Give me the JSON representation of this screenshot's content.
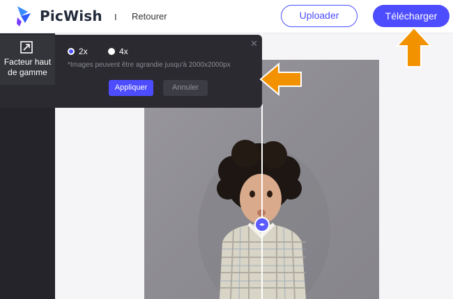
{
  "header": {
    "logo_text": "PicWish",
    "separator": "I",
    "back_label": "Retourer",
    "upload_label": "Uploader",
    "download_label": "Télécharger"
  },
  "upscale_panel": {
    "tab_label_line1": "Facteur haut",
    "tab_label_line2": "de gamme",
    "options": [
      {
        "label": "2x",
        "selected": true
      },
      {
        "label": "4x",
        "selected": false
      }
    ],
    "hint": "*Images peuvent être agrandie jusqu'à 2000x2000px",
    "apply_label": "Appliquer",
    "cancel_label": "Annuler",
    "close_symbol": "✕"
  },
  "compare_handle_symbol": "◂▸",
  "colors": {
    "accent": "#4d4dff",
    "panel_bg": "#2a2a30",
    "annotation_arrow": "#f39200"
  }
}
